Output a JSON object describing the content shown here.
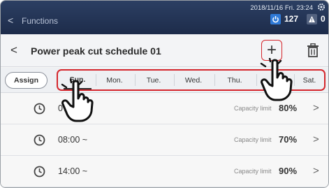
{
  "topbar": {
    "back_label": "<",
    "title": "Functions",
    "datetime": "2018/11/16 Fri. 23:24",
    "power_value": "127",
    "alert_value": "0",
    "icons": [
      "gear-icon",
      "power-icon",
      "alert-icon"
    ]
  },
  "header": {
    "back_label": "<",
    "title": "Power peak cut schedule 01",
    "add_label": "+",
    "add_highlight_color": "#d5262c"
  },
  "tabs": {
    "assign_label": "Assign",
    "days": [
      "Sun.",
      "Mon.",
      "Tue.",
      "Wed.",
      "Thu.",
      "",
      "Sat."
    ],
    "active_day": "Sun."
  },
  "rows": [
    {
      "time": "07",
      "capacity_label": "Capacity limit",
      "percent": "80%",
      "chevron": ">"
    },
    {
      "time": "08:00 ~",
      "capacity_label": "Capacity limit",
      "percent": "70%",
      "chevron": ">"
    },
    {
      "time": "14:00 ~",
      "capacity_label": "Capacity limit",
      "percent": "90%",
      "chevron": ">"
    }
  ]
}
